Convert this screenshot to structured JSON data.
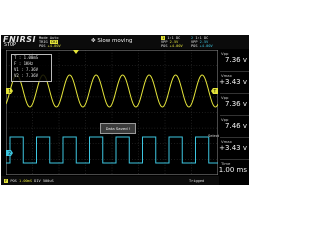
{
  "header": {
    "logo": "FNIRSI",
    "run_state": "STOP",
    "mode": "Auto",
    "mode_label": "Mode",
    "trig_label": "TRIG",
    "trig_channel": "CH1",
    "pos_label": "POS",
    "pos_value": "+4.00V",
    "slow_label": "Slow moving",
    "ch1_scale": "1:1",
    "ch1_coupling": "DC",
    "ch1_div": "2.5V",
    "ch1_pos": "+4.00V",
    "ch2_scale": "1:1",
    "ch2_coupling": "DC",
    "ch2_div": "2.5V",
    "ch2_pos": "+4.00V",
    "vpp_label": "VPP",
    "pos2_label": "POS"
  },
  "info_box": {
    "t_line": "T : 1.00mS",
    "f_line": "F : 1KHz",
    "v1_line": "V1 : 7.36V",
    "v2_line": "V2 : 7.36V"
  },
  "saved_popup": "Data Saved !",
  "select_label": "Select",
  "right_panel": [
    {
      "label": "Vpp",
      "value": "7.36 v"
    },
    {
      "label": "Vmax",
      "value": "+3.43 v"
    },
    {
      "label": "Vpp",
      "value": "7.36 v"
    },
    {
      "label": "Vpp",
      "value": "7.46 v"
    },
    {
      "label": "Vmax",
      "value": "+3.43 v"
    },
    {
      "label": "Time",
      "value": "1.00 ms"
    }
  ],
  "bottom": {
    "left_tag": "F",
    "pos_label": "POS",
    "pos_value": "1.00mS",
    "div_label": "DIV",
    "div_value": "500uS",
    "status": "Trigged"
  },
  "markers": {
    "ch1": "1",
    "ch2": "2",
    "trig": "T"
  },
  "colors": {
    "ch1": "#e4e43a",
    "ch2": "#3dc6e0",
    "background": "#000000",
    "grid": "#5a5a5a"
  }
}
